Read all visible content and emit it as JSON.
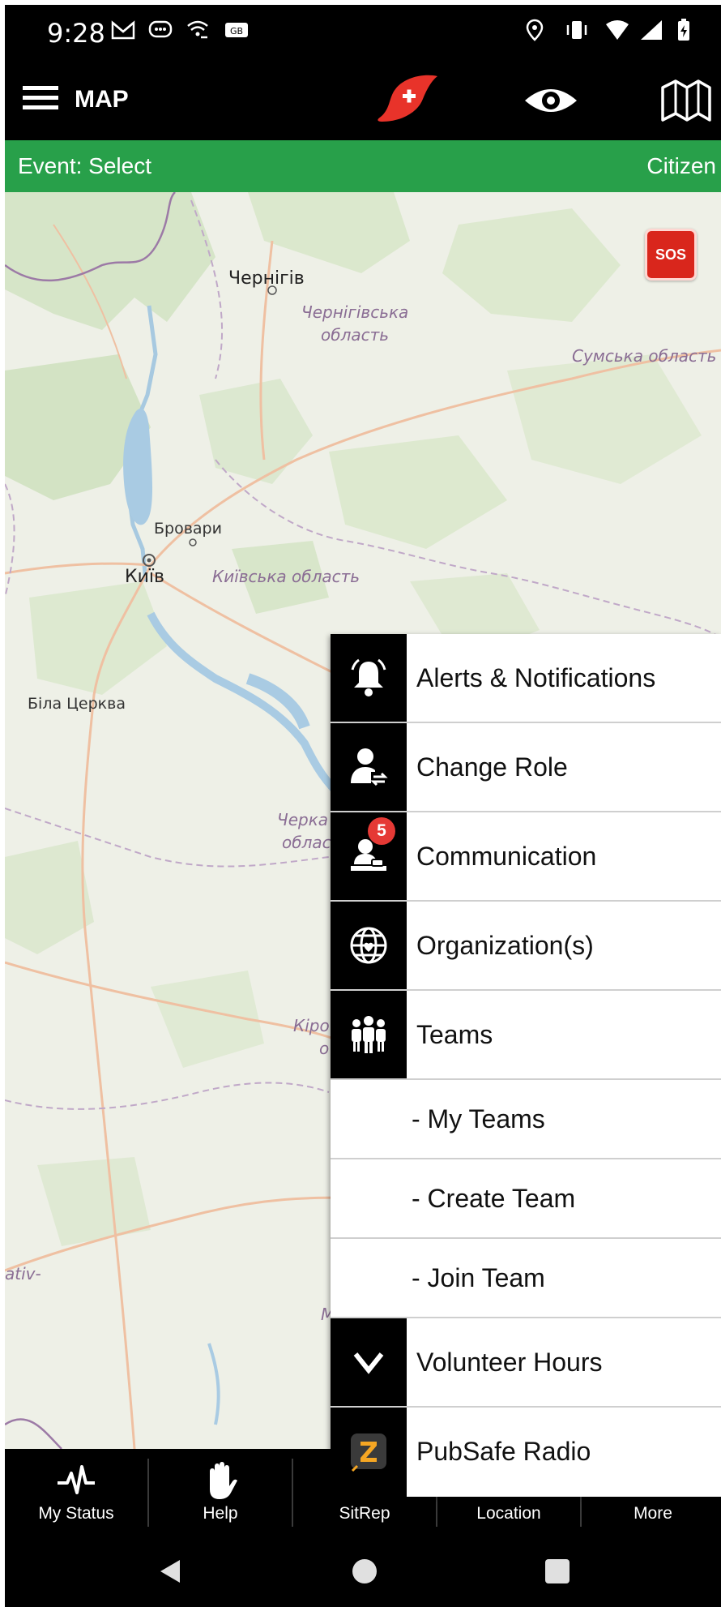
{
  "status_bar": {
    "time": "9:28"
  },
  "app_bar": {
    "title": "MAP"
  },
  "event_bar": {
    "event": "Event: Select",
    "role": "Citizen"
  },
  "map": {
    "labels": {
      "chernihiv": "Чернігів",
      "chernihiv_oblast_1": "Чернігівська",
      "chernihiv_oblast_2": "область",
      "sumy_oblast": "Сумська область",
      "brovary": "Бровари",
      "kyiv": "Київ",
      "kyiv_oblast": "Київська область",
      "bila_tserkva": "Біла Церква",
      "cherkasy_1": "Черка",
      "cherkasy_2": "облас",
      "kirovohrad_1": "Кіро",
      "kirovohrad_2": "о",
      "edge_label": "ativ-",
      "m_label": "М"
    },
    "sos_label": "SOS"
  },
  "popup_menu": {
    "items": [
      {
        "label": "Alerts & Notifications",
        "icon": "bell-icon"
      },
      {
        "label": "Change Role",
        "icon": "change-role-icon"
      },
      {
        "label": "Communication",
        "icon": "communication-icon",
        "badge": "5"
      },
      {
        "label": "Organization(s)",
        "icon": "globe-icon"
      },
      {
        "label": "Teams",
        "icon": "teams-icon"
      },
      {
        "label": "- My Teams"
      },
      {
        "label": "- Create Team"
      },
      {
        "label": "- Join Team"
      },
      {
        "label": "Volunteer Hours",
        "icon": "chevron-down-icon"
      },
      {
        "label": "PubSafe Radio",
        "icon": "radio-icon"
      }
    ]
  },
  "bottom_nav": {
    "items": [
      {
        "label": "My Status",
        "icon": "pulse-icon"
      },
      {
        "label": "Help",
        "icon": "hand-icon"
      },
      {
        "label": "SitRep",
        "icon": "sitrep-icon"
      },
      {
        "label": "Location",
        "icon": "location-icon"
      },
      {
        "label": "More",
        "icon": "more-icon"
      }
    ]
  },
  "colors": {
    "event_bar": "#28a04a",
    "sos": "#d9261c",
    "badge": "#e53935",
    "logo_red": "#e8332a"
  }
}
